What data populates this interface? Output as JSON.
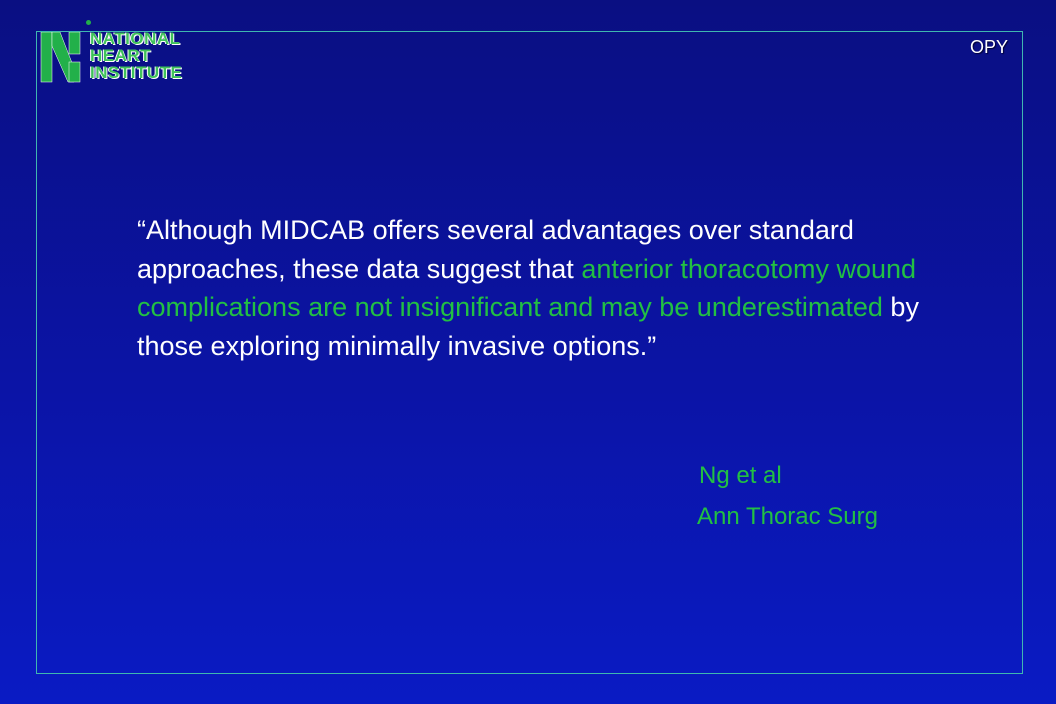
{
  "slide": {
    "tag": "OPY",
    "logo": {
      "line1": "NATIONAL",
      "line2": "HEART",
      "line3": "INSTITUTE"
    },
    "quote": {
      "part1": "“Although MIDCAB offers several advantages over standard approaches, these data suggest that ",
      "highlight": "anterior thoracotomy wound complications are not insignificant and may be underestimated",
      "part2": " by those exploring minimally invasive options.”"
    },
    "citation": {
      "authors": "Ng et al",
      "journal": "Ann Thorac Surg"
    }
  },
  "colors": {
    "background_top": "#0a0f82",
    "background_bottom": "#0a1bc4",
    "frame": "#3fb7b0",
    "highlight": "#22c043",
    "text": "#ffffff"
  }
}
